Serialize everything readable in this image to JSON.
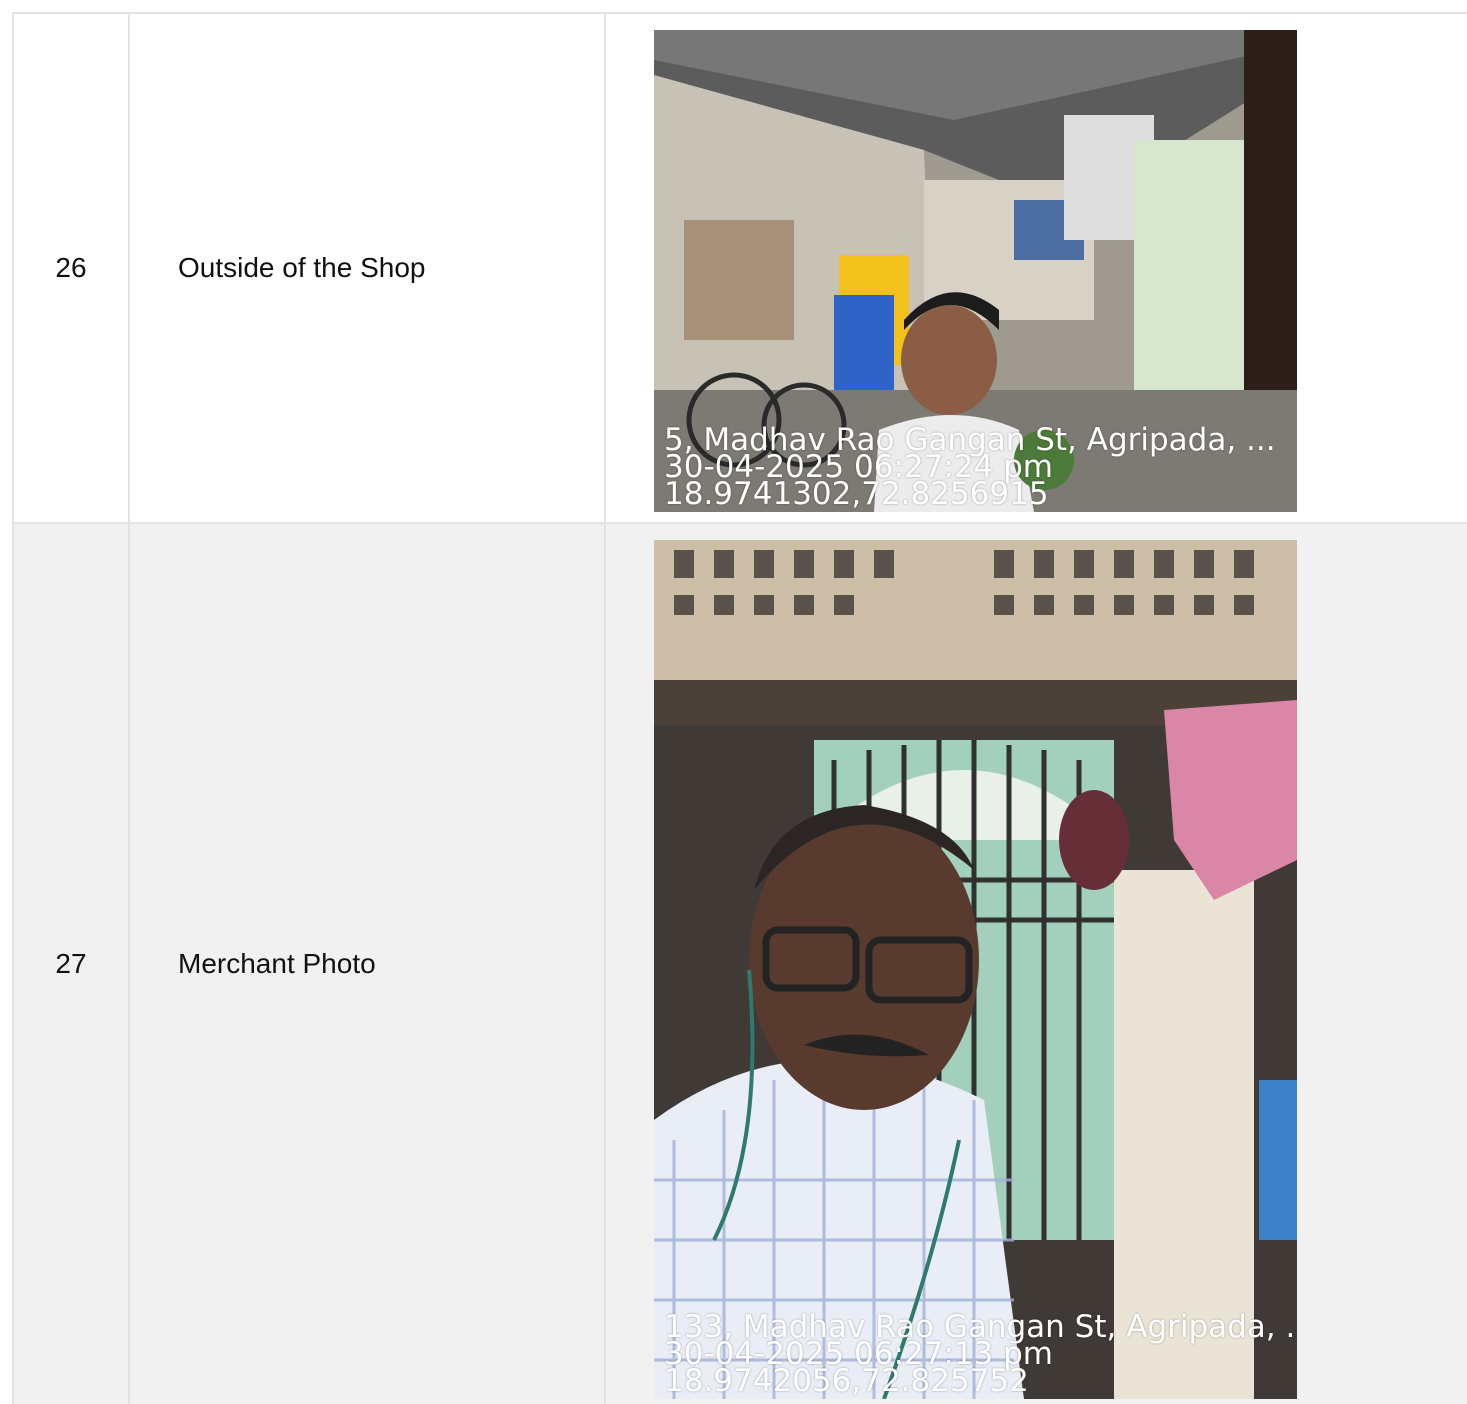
{
  "rows": [
    {
      "number": "26",
      "label": "Outside of the Shop",
      "photo": {
        "address": "5, Madhav Rao Gangan St, Agripada, ...",
        "datetime": "30-04-2025 06:27:24 pm",
        "coords": "18.9741302,72.8256915"
      }
    },
    {
      "number": "27",
      "label": "Merchant Photo",
      "photo": {
        "address": "133, Madhav Rao Gangan St, Agripada, ...",
        "datetime": "30-04-2025 06:27:13 pm",
        "coords": "18.9742056,72.825752"
      }
    }
  ]
}
